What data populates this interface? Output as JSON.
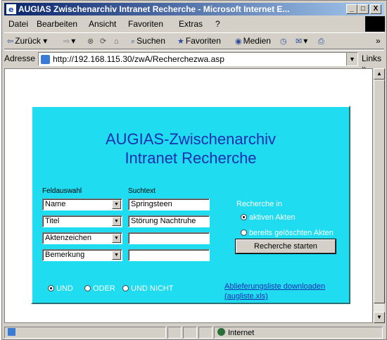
{
  "window": {
    "title": "AUGIAS Zwischenarchiv Intranet Recherche - Microsoft Internet E...",
    "controls": {
      "minimize": "_",
      "maximize": "□",
      "close": "X"
    }
  },
  "menu": {
    "items": [
      {
        "label": "Datei"
      },
      {
        "label": "Bearbeiten"
      },
      {
        "label": "Ansicht"
      },
      {
        "label": "Favoriten"
      },
      {
        "label": "Extras"
      },
      {
        "label": "?"
      }
    ]
  },
  "toolbar": {
    "back": "Zurück",
    "search": "Suchen",
    "favorites": "Favoriten",
    "media": "Medien"
  },
  "address": {
    "label": "Adresse",
    "url": "http://192.168.115.30/zwA/Recherchezwa.asp",
    "links": "Links"
  },
  "page": {
    "title_line1": "AUGIAS-Zwischenarchiv",
    "title_line2": "Intranet Recherche",
    "field_header": "Feldauswahl",
    "search_header": "Suchtext",
    "rows": [
      {
        "field": "Name",
        "text": "Springsteen"
      },
      {
        "field": "Titel",
        "text": "Störung Nachtruhe"
      },
      {
        "field": "Aktenzeichen",
        "text": ""
      },
      {
        "field": "Bemerkung",
        "text": ""
      }
    ],
    "recherche_in": "Recherche in",
    "scope_options": [
      {
        "label": "aktiven Akten",
        "selected": true
      },
      {
        "label": "bereits gelöschten Akten",
        "selected": false
      }
    ],
    "start_button": "Recherche starten",
    "logic_options": [
      {
        "label": "UND",
        "selected": true
      },
      {
        "label": "ODER",
        "selected": false
      },
      {
        "label": "UND NICHT",
        "selected": false
      }
    ],
    "download_link_line1": "Ablieferungsliste downloaden",
    "download_link_line2": "(augliste.xls)"
  },
  "status": {
    "zone": "Internet"
  },
  "colors": {
    "panel_bg": "#1fdcf0",
    "title_text": "#1a2fb0",
    "titlebar_start": "#0a246a"
  }
}
